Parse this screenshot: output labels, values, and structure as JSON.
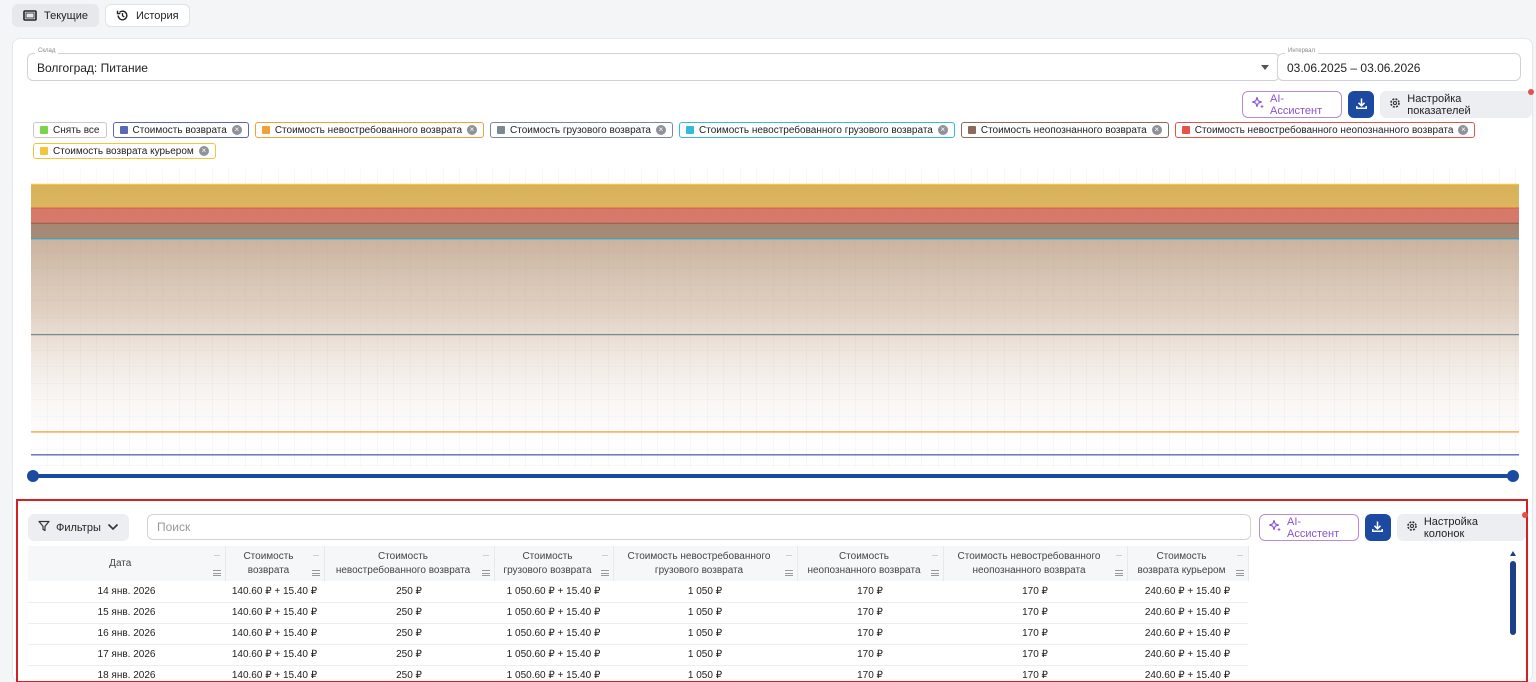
{
  "nav": {
    "current_label": "Текущие",
    "history_label": "История"
  },
  "filters": {
    "warehouse_label": "Склад",
    "warehouse_value": "Волгоград: Питание",
    "interval_label": "Интервал",
    "interval_value": "03.06.2025 – 03.06.2026"
  },
  "chart_toolbar": {
    "ai_label": "AI-Ассистент",
    "settings_label": "Настройка показателей"
  },
  "chips": [
    {
      "label": "Снять все",
      "color": "#7cd44c",
      "border": "#c9c9c9",
      "removable": false
    },
    {
      "label": "Стоимость возврата",
      "color": "#5a67b8",
      "border": "#5a67b8",
      "removable": true
    },
    {
      "label": "Стоимость невостребованного возврата",
      "color": "#f0a13a",
      "border": "#f0a13a",
      "removable": true
    },
    {
      "label": "Стоимость грузового возврата",
      "color": "#7b8a91",
      "border": "#7b8a91",
      "removable": true
    },
    {
      "label": "Стоимость невостребованного грузового возврата",
      "color": "#36b8e0",
      "border": "#36b8e0",
      "removable": true
    },
    {
      "label": "Стоимость неопознанного возврата",
      "color": "#8a6a58",
      "border": "#8a6a58",
      "removable": true
    },
    {
      "label": "Стоимость невостребованного неопознанного возврата",
      "color": "#e5534b",
      "border": "#e5534b",
      "removable": true
    },
    {
      "label": "Стоимость возврата курьером",
      "color": "#f2c53d",
      "border": "#f2c53d",
      "removable": true
    }
  ],
  "chart_data": {
    "type": "area",
    "x": [
      "14 янв. 2026",
      "15 янв. 2026",
      "16 янв. 2026",
      "17 янв. 2026",
      "18 янв. 2026"
    ],
    "series": [
      {
        "name": "Стоимость возврата",
        "color": "#5a67b8",
        "values": [
          156.0,
          156.0,
          156.0,
          156.0,
          156.0
        ]
      },
      {
        "name": "Стоимость невостребованного возврата",
        "color": "#f0a13a",
        "values": [
          250,
          250,
          250,
          250,
          250
        ]
      },
      {
        "name": "Стоимость грузового возврата",
        "color": "#7b8a91",
        "values": [
          1066.0,
          1066.0,
          1066.0,
          1066.0,
          1066.0
        ]
      },
      {
        "name": "Стоимость невостребованного грузового возврата",
        "color": "#36b8e0",
        "values": [
          1050,
          1050,
          1050,
          1050,
          1050
        ]
      },
      {
        "name": "Стоимость неопознанного возврата",
        "color": "#8a6a58",
        "values": [
          170,
          170,
          170,
          170,
          170
        ]
      },
      {
        "name": "Стоимость невостребованного неопознанного возврата",
        "color": "#e5534b",
        "values": [
          170,
          170,
          170,
          170,
          170
        ]
      },
      {
        "name": "Стоимость возврата курьером",
        "color": "#f2c53d",
        "values": [
          256.0,
          256.0,
          256.0,
          256.0,
          256.0
        ]
      }
    ],
    "stacked": true,
    "grid": true,
    "legend": "top"
  },
  "table": {
    "filters_label": "Фильтры",
    "search_placeholder": "Поиск",
    "ai_label": "AI-Ассистент",
    "settings_label": "Настройка колонок",
    "columns": [
      {
        "l1": "Дата",
        "l2": ""
      },
      {
        "l1": "Стоимость",
        "l2": "возврата"
      },
      {
        "l1": "Стоимость",
        "l2": "невостребованного возврата"
      },
      {
        "l1": "Стоимость",
        "l2": "грузового возврата"
      },
      {
        "l1": "Стоимость невостребованного",
        "l2": "грузового возврата"
      },
      {
        "l1": "Стоимость",
        "l2": "неопознанного возврата"
      },
      {
        "l1": "Стоимость невостребованного",
        "l2": "неопознанного возврата"
      },
      {
        "l1": "Стоимость",
        "l2": "возврата курьером"
      }
    ],
    "rows": [
      [
        "14 янв. 2026",
        "140.60 ₽ + 15.40 ₽",
        "250 ₽",
        "1 050.60 ₽ + 15.40 ₽",
        "1 050 ₽",
        "170 ₽",
        "170 ₽",
        "240.60 ₽ + 15.40 ₽"
      ],
      [
        "15 янв. 2026",
        "140.60 ₽ + 15.40 ₽",
        "250 ₽",
        "1 050.60 ₽ + 15.40 ₽",
        "1 050 ₽",
        "170 ₽",
        "170 ₽",
        "240.60 ₽ + 15.40 ₽"
      ],
      [
        "16 янв. 2026",
        "140.60 ₽ + 15.40 ₽",
        "250 ₽",
        "1 050.60 ₽ + 15.40 ₽",
        "1 050 ₽",
        "170 ₽",
        "170 ₽",
        "240.60 ₽ + 15.40 ₽"
      ],
      [
        "17 янв. 2026",
        "140.60 ₽ + 15.40 ₽",
        "250 ₽",
        "1 050.60 ₽ + 15.40 ₽",
        "1 050 ₽",
        "170 ₽",
        "170 ₽",
        "240.60 ₽ + 15.40 ₽"
      ],
      [
        "18 янв. 2026",
        "140.60 ₽ + 15.40 ₽",
        "250 ₽",
        "1 050.60 ₽ + 15.40 ₽",
        "1 050 ₽",
        "170 ₽",
        "170 ₽",
        "240.60 ₽ + 15.40 ₽"
      ]
    ]
  },
  "colors": {
    "accent": "#1c4aa0",
    "ai": "#8a52c9",
    "highlight_border": "#d42020"
  }
}
